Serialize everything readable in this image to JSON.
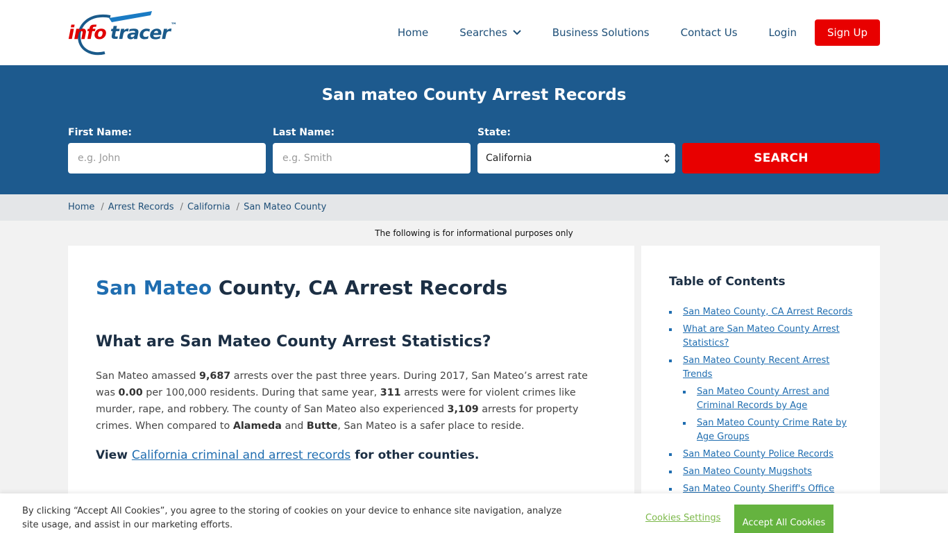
{
  "header": {
    "logo": {
      "info": "info",
      "tracer": "tracer",
      "tm": "™"
    },
    "nav": {
      "home": "Home",
      "searches": "Searches",
      "business": "Business Solutions",
      "contact": "Contact Us",
      "login": "Login",
      "signup": "Sign Up"
    }
  },
  "hero": {
    "title": "San mateo County Arrest Records",
    "first_name": {
      "label": "First Name:",
      "placeholder": "e.g. John"
    },
    "last_name": {
      "label": "Last Name:",
      "placeholder": "e.g. Smith"
    },
    "state": {
      "label": "State:",
      "value": "California"
    },
    "search_label": "SEARCH"
  },
  "breadcrumb": {
    "items": [
      "Home",
      "Arrest Records",
      "California",
      "San Mateo County"
    ],
    "separator": "/"
  },
  "notice": "The following is for informational purposes only",
  "main": {
    "title_highlight": "San Mateo",
    "title_rest": " County, CA Arrest Records",
    "stats_heading": "What are San Mateo County Arrest Statistics?",
    "para": {
      "p1": "San Mateo amassed ",
      "arrests_total": "9,687",
      "p2": " arrests over the past three years. During 2017, San Mateo’s arrest rate was ",
      "rate": "0.00",
      "p3": " per 100,000 residents. During that same year, ",
      "violent": "311",
      "p4": " arrests were for violent crimes like murder, rape, and robbery. The county of San Mateo also experienced ",
      "property": "3,109",
      "p5": " arrests for property crimes. When compared to ",
      "county1": "Alameda",
      "p6": " and ",
      "county2": "Butte",
      "p7": ", San Mateo is a safer place to reside."
    },
    "view_prefix": "View ",
    "view_link": "California criminal and arrest records",
    "view_suffix": " for other counties."
  },
  "toc": {
    "title": "Table of Contents",
    "items": [
      "San Mateo County, CA Arrest Records",
      "What are San Mateo County Arrest Statistics?",
      "San Mateo County Recent Arrest Trends",
      "San Mateo County Arrest and Criminal Records by Age",
      "San Mateo County Crime Rate by Age Groups",
      "San Mateo County Police Records",
      "San Mateo County Mugshots",
      "San Mateo County Sheriff's Office"
    ]
  },
  "cookie": {
    "text": "By clicking “Accept All Cookies”, you agree to the storing of cookies on your device to enhance site navigation, analyze site usage, and assist in our marketing efforts.",
    "settings": "Cookies Settings",
    "accept": "Accept All Cookies"
  },
  "colors": {
    "brand_blue": "#1d5a8e",
    "brand_red": "#e80000",
    "link_blue": "#1f6db0",
    "accept_green": "#65b33f"
  }
}
